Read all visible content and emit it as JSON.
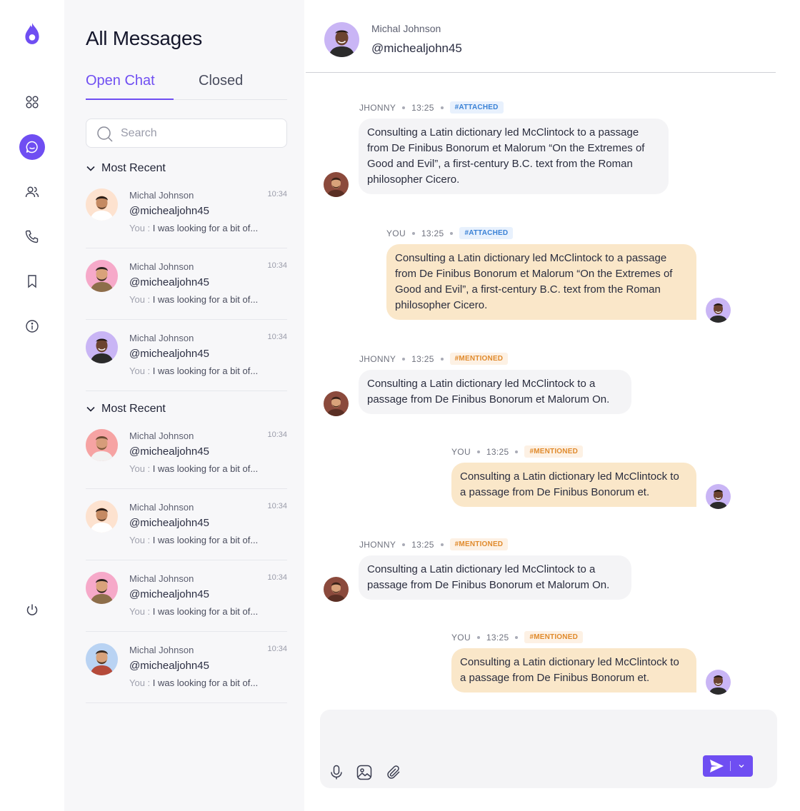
{
  "app": {
    "accent": "#6f4ef2"
  },
  "rail": {
    "items": [
      {
        "icon": "flame-logo-icon"
      },
      {
        "icon": "grid-icon"
      },
      {
        "icon": "chat-icon",
        "active": true
      },
      {
        "icon": "users-icon"
      },
      {
        "icon": "phone-icon"
      },
      {
        "icon": "bookmark-icon"
      },
      {
        "icon": "info-icon"
      },
      {
        "icon": "power-icon"
      }
    ]
  },
  "list": {
    "title": "All Messages",
    "tabs": {
      "open": "Open Chat",
      "closed": "Closed"
    },
    "search_placeholder": "Search",
    "section1": {
      "label": "Most Recent",
      "items": [
        {
          "name": "Michal Johnson",
          "time": "10:34",
          "handle": "@michealjohn45",
          "you": "You :",
          "preview": "I was looking for a bit of..."
        },
        {
          "name": "Michal Johnson",
          "time": "10:34",
          "handle": "@michealjohn45",
          "you": "You :",
          "preview": "I was looking for a bit of..."
        },
        {
          "name": "Michal Johnson",
          "time": "10:34",
          "handle": "@michealjohn45",
          "you": "You :",
          "preview": "I was looking for a bit of..."
        }
      ]
    },
    "section2": {
      "label": "Most Recent",
      "items": [
        {
          "name": "Michal Johnson",
          "time": "10:34",
          "handle": "@michealjohn45",
          "you": "You :",
          "preview": "I was looking for a bit of..."
        },
        {
          "name": "Michal Johnson",
          "time": "10:34",
          "handle": "@michealjohn45",
          "you": "You :",
          "preview": "I was looking for a bit of..."
        },
        {
          "name": "Michal Johnson",
          "time": "10:34",
          "handle": "@michealjohn45",
          "you": "You :",
          "preview": "I was looking for a bit of..."
        },
        {
          "name": "Michal Johnson",
          "time": "10:34",
          "handle": "@michealjohn45",
          "you": "You :",
          "preview": "I was looking for a bit of..."
        }
      ]
    }
  },
  "chat": {
    "header": {
      "name": "Michal Johnson",
      "handle": "@michealjohn45"
    },
    "messages": [
      {
        "sender": "JHONNY",
        "time": "13:25",
        "tag": "#ATTACHED",
        "text": "Consulting a Latin dictionary led McClintock to a passage from De Finibus Bonorum et Malorum “On the Extremes of Good and Evil”, a first-century B.C. text from the Roman philosopher Cicero."
      },
      {
        "sender": "YOU",
        "time": "13:25",
        "tag": "#ATTACHED",
        "text": "Consulting a Latin dictionary led McClintock to a passage from De Finibus Bonorum et Malorum “On the Extremes of Good and Evil”, a first-century B.C. text from the Roman philosopher Cicero."
      },
      {
        "sender": "JHONNY",
        "time": "13:25",
        "tag": "#MENTIONED",
        "text": "Consulting a Latin dictionary led McClintock to a passage from De Finibus Bonorum et Malorum  On."
      },
      {
        "sender": "YOU",
        "time": "13:25",
        "tag": "#MENTIONED",
        "text": "Consulting a Latin dictionary led McClintock to a passage from De Finibus Bonorum et."
      },
      {
        "sender": "JHONNY",
        "time": "13:25",
        "tag": "#MENTIONED",
        "text": "Consulting a Latin dictionary led McClintock to a passage from De Finibus Bonorum et Malorum  On."
      },
      {
        "sender": "YOU",
        "time": "13:25",
        "tag": "#MENTIONED",
        "text": "Consulting a Latin dictionary led McClintock to a passage from De Finibus Bonorum et."
      }
    ],
    "composer": {
      "tools": [
        "microphone-icon",
        "image-icon",
        "paperclip-icon"
      ],
      "send_icon": "send-icon"
    }
  }
}
